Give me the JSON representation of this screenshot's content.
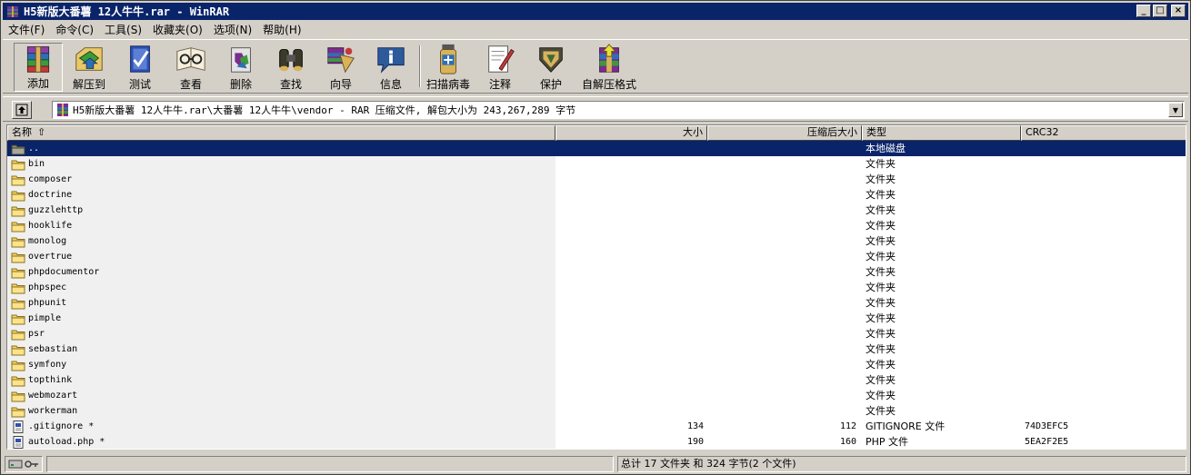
{
  "window": {
    "title": "H5新版大番薯 12人牛牛.rar - WinRAR",
    "minimize_glyph": "_",
    "maximize_glyph": "□",
    "close_glyph": "×"
  },
  "menu": [
    "文件(F)",
    "命令(C)",
    "工具(S)",
    "收藏夹(O)",
    "选项(N)",
    "帮助(H)"
  ],
  "toolbar": {
    "buttons": [
      {
        "label": "添加",
        "icon": "add-archive-icon"
      },
      {
        "label": "解压到",
        "icon": "extract-to-icon"
      },
      {
        "label": "测试",
        "icon": "test-icon"
      },
      {
        "label": "查看",
        "icon": "view-icon"
      },
      {
        "label": "删除",
        "icon": "delete-icon"
      },
      {
        "label": "查找",
        "icon": "find-icon"
      },
      {
        "label": "向导",
        "icon": "wizard-icon"
      },
      {
        "label": "信息",
        "icon": "info-icon"
      },
      {
        "label": "扫描病毒",
        "icon": "virus-scan-icon"
      },
      {
        "label": "注释",
        "icon": "comment-icon"
      },
      {
        "label": "保护",
        "icon": "protect-icon"
      },
      {
        "label": "自解压格式",
        "icon": "sfx-icon"
      }
    ]
  },
  "address": {
    "path": "H5新版大番薯 12人牛牛.rar\\大番薯 12人牛牛\\vendor - RAR 压缩文件, 解包大小为 243,267,289 字节"
  },
  "columns": {
    "name": "名称",
    "size": "大小",
    "packed": "压缩后大小",
    "type": "类型",
    "crc": "CRC32"
  },
  "files": [
    {
      "name": "..",
      "size": "",
      "packed": "",
      "type": "本地磁盘",
      "crc": "",
      "kind": "parent",
      "selected": true
    },
    {
      "name": "bin",
      "size": "",
      "packed": "",
      "type": "文件夹",
      "crc": "",
      "kind": "folder"
    },
    {
      "name": "composer",
      "size": "",
      "packed": "",
      "type": "文件夹",
      "crc": "",
      "kind": "folder"
    },
    {
      "name": "doctrine",
      "size": "",
      "packed": "",
      "type": "文件夹",
      "crc": "",
      "kind": "folder"
    },
    {
      "name": "guzzlehttp",
      "size": "",
      "packed": "",
      "type": "文件夹",
      "crc": "",
      "kind": "folder"
    },
    {
      "name": "hooklife",
      "size": "",
      "packed": "",
      "type": "文件夹",
      "crc": "",
      "kind": "folder"
    },
    {
      "name": "monolog",
      "size": "",
      "packed": "",
      "type": "文件夹",
      "crc": "",
      "kind": "folder"
    },
    {
      "name": "overtrue",
      "size": "",
      "packed": "",
      "type": "文件夹",
      "crc": "",
      "kind": "folder"
    },
    {
      "name": "phpdocumentor",
      "size": "",
      "packed": "",
      "type": "文件夹",
      "crc": "",
      "kind": "folder"
    },
    {
      "name": "phpspec",
      "size": "",
      "packed": "",
      "type": "文件夹",
      "crc": "",
      "kind": "folder"
    },
    {
      "name": "phpunit",
      "size": "",
      "packed": "",
      "type": "文件夹",
      "crc": "",
      "kind": "folder"
    },
    {
      "name": "pimple",
      "size": "",
      "packed": "",
      "type": "文件夹",
      "crc": "",
      "kind": "folder"
    },
    {
      "name": "psr",
      "size": "",
      "packed": "",
      "type": "文件夹",
      "crc": "",
      "kind": "folder"
    },
    {
      "name": "sebastian",
      "size": "",
      "packed": "",
      "type": "文件夹",
      "crc": "",
      "kind": "folder"
    },
    {
      "name": "symfony",
      "size": "",
      "packed": "",
      "type": "文件夹",
      "crc": "",
      "kind": "folder"
    },
    {
      "name": "topthink",
      "size": "",
      "packed": "",
      "type": "文件夹",
      "crc": "",
      "kind": "folder"
    },
    {
      "name": "webmozart",
      "size": "",
      "packed": "",
      "type": "文件夹",
      "crc": "",
      "kind": "folder"
    },
    {
      "name": "workerman",
      "size": "",
      "packed": "",
      "type": "文件夹",
      "crc": "",
      "kind": "folder"
    },
    {
      "name": ".gitignore *",
      "size": "134",
      "packed": "112",
      "type": "GITIGNORE 文件",
      "crc": "74D3EFC5",
      "kind": "file"
    },
    {
      "name": "autoload.php *",
      "size": "190",
      "packed": "160",
      "type": "PHP 文件",
      "crc": "5EA2F2E5",
      "kind": "file"
    }
  ],
  "status": {
    "summary": "总计 17 文件夹 和 324 字节(2 个文件)"
  },
  "colors": {
    "titlebar": "#0a246a",
    "selection": "#0a246a",
    "face": "#d4d0c8",
    "folder": "#f5d565"
  }
}
